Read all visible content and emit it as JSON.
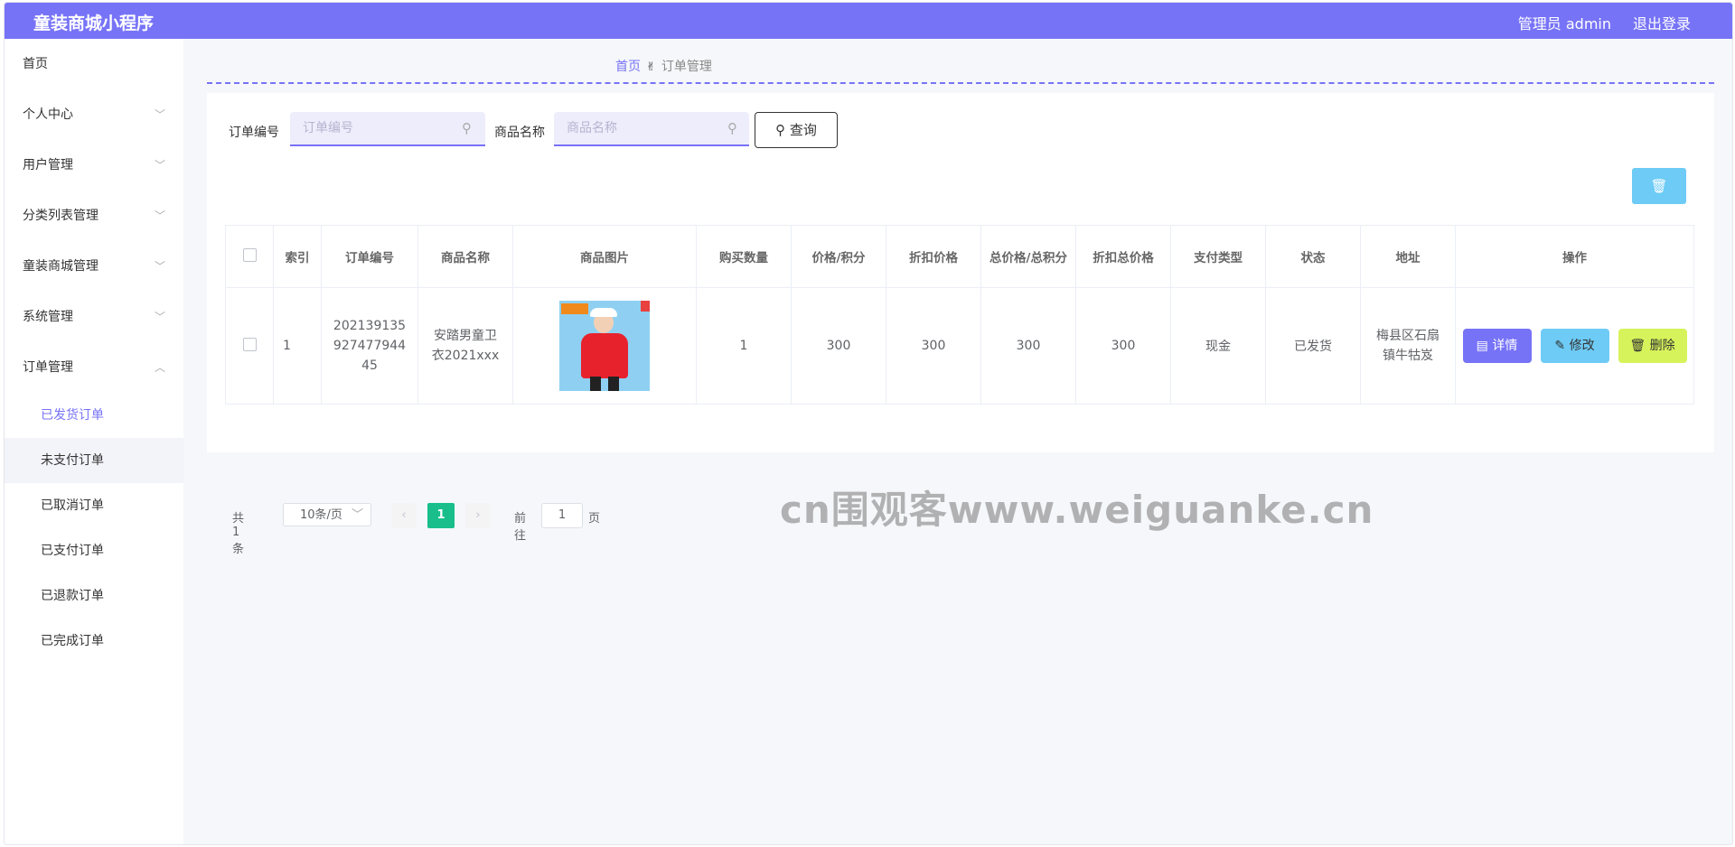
{
  "header": {
    "title": "童装商城小程序",
    "user": "管理员 admin",
    "logout": "退出登录"
  },
  "sidebar": {
    "items": [
      {
        "label": "首页"
      },
      {
        "label": "个人中心"
      },
      {
        "label": "用户管理"
      },
      {
        "label": "分类列表管理"
      },
      {
        "label": "童装商城管理"
      },
      {
        "label": "系统管理"
      },
      {
        "label": "订单管理"
      }
    ],
    "sub_items": [
      {
        "label": "已发货订单"
      },
      {
        "label": "未支付订单"
      },
      {
        "label": "已取消订单"
      },
      {
        "label": "已支付订单"
      },
      {
        "label": "已退款订单"
      },
      {
        "label": "已完成订单"
      }
    ]
  },
  "breadcrumb": {
    "home": "首页",
    "current": "订单管理"
  },
  "search": {
    "order_no_label": "订单编号",
    "order_no_placeholder": "订单编号",
    "product_label": "商品名称",
    "product_placeholder": "商品名称",
    "query_label": "查询"
  },
  "table": {
    "headers": [
      "索引",
      "订单编号",
      "商品名称",
      "商品图片",
      "购买数量",
      "价格/积分",
      "折扣价格",
      "总价格/总积分",
      "折扣总价格",
      "支付类型",
      "状态",
      "地址",
      "操作"
    ],
    "rows": [
      {
        "index": "1",
        "order_no": "20213913592747794445",
        "product": "安踏男童卫衣2021xxx",
        "quantity": "1",
        "price": "300",
        "discount_price": "300",
        "total": "300",
        "discount_total": "300",
        "pay_type": "现金",
        "status": "已发货",
        "address": "梅县区石扇镇牛牯岌",
        "ops": {
          "detail": "详情",
          "edit": "修改",
          "delete": "删除"
        }
      }
    ]
  },
  "pagination": {
    "total": "共 1 条",
    "page_size": "10条/页",
    "current_page": "1",
    "goto_label": "前往",
    "goto_value": "1",
    "page_suffix": "页"
  },
  "watermark": "cn围观客www.weiguanke.cn",
  "colors": {
    "primary": "#7773f7",
    "info": "#6ecbf6",
    "warning": "#d6f35b",
    "success": "#19be8b"
  }
}
